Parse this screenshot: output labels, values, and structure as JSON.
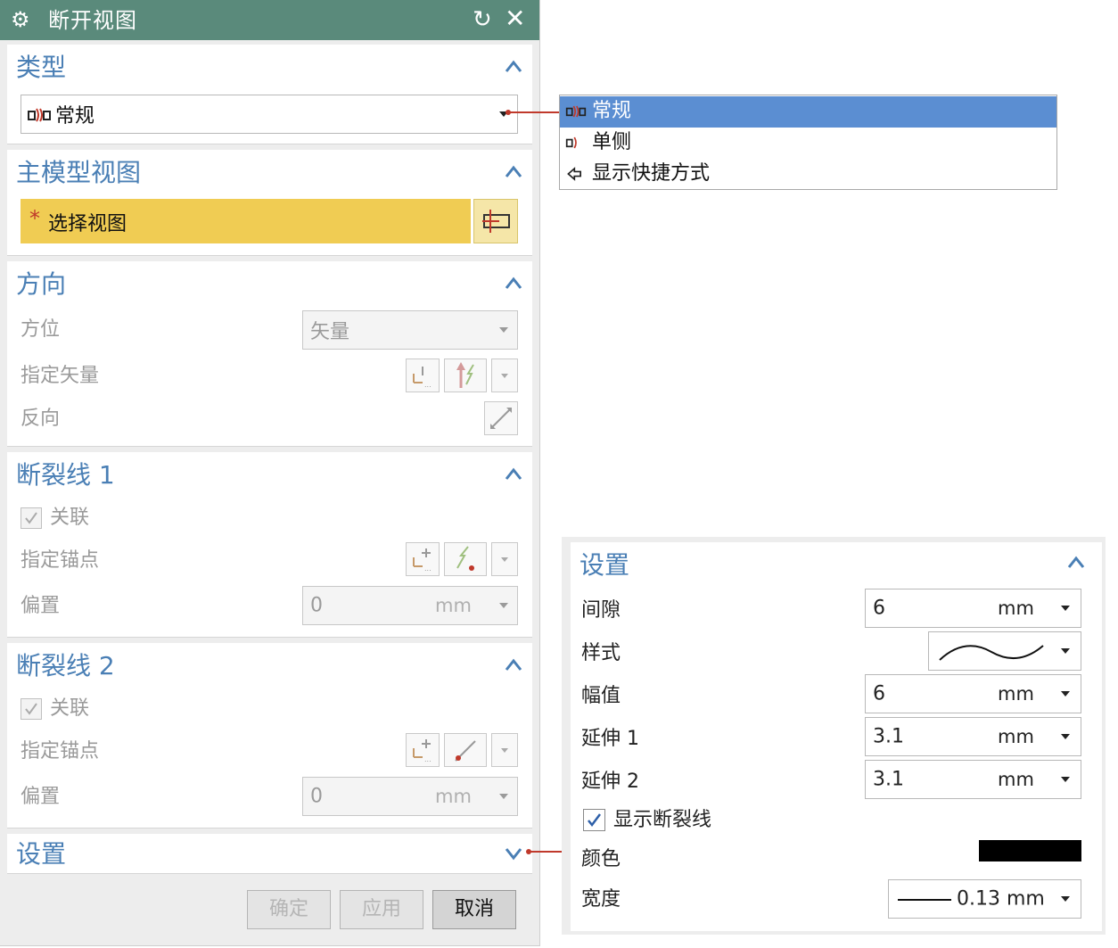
{
  "dialog": {
    "title": "断开视图",
    "type_section": {
      "header": "类型",
      "selected": "常规"
    },
    "main_view_section": {
      "header": "主模型视图",
      "required_mark": "*",
      "select_label": "选择视图"
    },
    "direction_section": {
      "header": "方向",
      "orientation_label": "方位",
      "orientation_value": "矢量",
      "vector_label": "指定矢量",
      "reverse_label": "反向"
    },
    "break1_section": {
      "header": "断裂线 1",
      "associative_label": "关联",
      "anchor_label": "指定锚点",
      "offset_label": "偏置",
      "offset_value": "0",
      "offset_unit": "mm"
    },
    "break2_section": {
      "header": "断裂线 2",
      "associative_label": "关联",
      "anchor_label": "指定锚点",
      "offset_label": "偏置",
      "offset_value": "0",
      "offset_unit": "mm"
    },
    "settings_section": {
      "header": "设置"
    },
    "buttons": {
      "ok": "确定",
      "apply": "应用",
      "cancel": "取消"
    }
  },
  "type_dropdown": {
    "options": [
      "常规",
      "单侧",
      "显示快捷方式"
    ],
    "selected_index": 0
  },
  "settings_panel": {
    "header": "设置",
    "gap_label": "间隙",
    "gap_value": "6",
    "gap_unit": "mm",
    "style_label": "样式",
    "amplitude_label": "幅值",
    "amplitude_value": "6",
    "amplitude_unit": "mm",
    "extend1_label": "延伸 1",
    "extend1_value": "3.1",
    "extend1_unit": "mm",
    "extend2_label": "延伸 2",
    "extend2_value": "3.1",
    "extend2_unit": "mm",
    "show_break_label": "显示断裂线",
    "color_label": "颜色",
    "color_value": "#000000",
    "width_label": "宽度",
    "width_value": "0.13 mm"
  },
  "colors": {
    "title_bar": "#5a8a7b",
    "section_header": "#4a7fb5",
    "selection_highlight": "#f0cc53",
    "popup_selected": "#5b8ed2",
    "callout": "#c0392b"
  }
}
